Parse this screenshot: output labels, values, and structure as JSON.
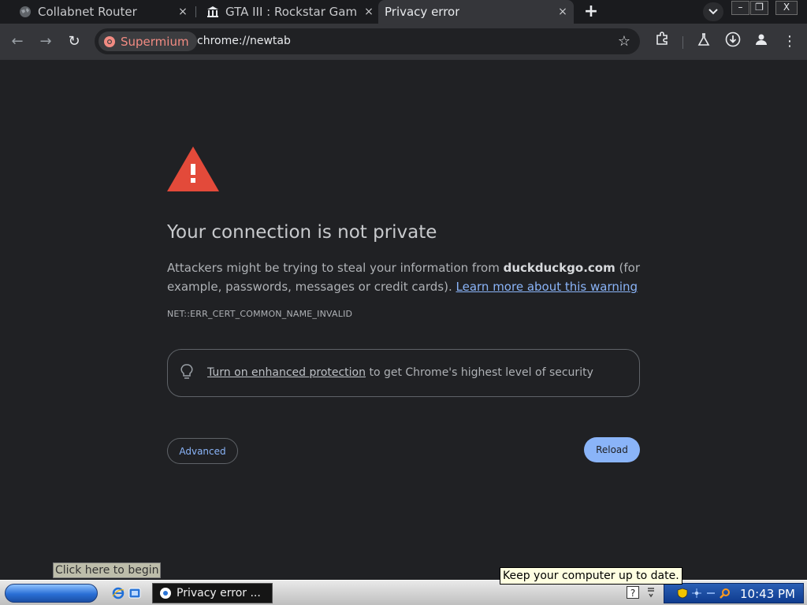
{
  "tabs": [
    {
      "title": "Collabnet Router",
      "icon": "globe-icon",
      "active": false
    },
    {
      "title": "GTA III : Rockstar Games",
      "icon": "museum-icon",
      "active": false
    },
    {
      "title": "Privacy error",
      "icon": "none",
      "active": true
    }
  ],
  "tab_controls": {
    "new_tab": "+",
    "tab_search": "⌄",
    "close": "×"
  },
  "window_controls": {
    "minimize": "–",
    "restore": "❐",
    "close": "X"
  },
  "toolbar": {
    "chip_label": "Supermium",
    "url": "chrome://newtab",
    "back": "←",
    "forward": "→",
    "reload": "↻",
    "star": "☆",
    "extensions": "⧉",
    "labs": "⚗",
    "download": "⊙",
    "profile": "●",
    "menu": "⋮"
  },
  "interstitial": {
    "title": "Your connection is not private",
    "body_prefix": "Attackers might be trying to steal your information from ",
    "domain": "duckduckgo.com",
    "body_suffix": " (for example, passwords, messages or credit cards). ",
    "learn_more": "Learn more about this warning",
    "error_code": "NET::ERR_CERT_COMMON_NAME_INVALID",
    "enhanced_link": "Turn on enhanced protection",
    "enhanced_suffix": " to get Chrome's highest level of security",
    "advanced_label": "Advanced",
    "reload_label": "Reload",
    "accent_color": "#8ab4f8",
    "warning_color": "#e34a3a"
  },
  "tooltips": {
    "start": "Click here to begin",
    "update": "Keep your computer up to date."
  },
  "taskbar": {
    "task_title": "Privacy error ...",
    "clock": "10:43 PM"
  }
}
